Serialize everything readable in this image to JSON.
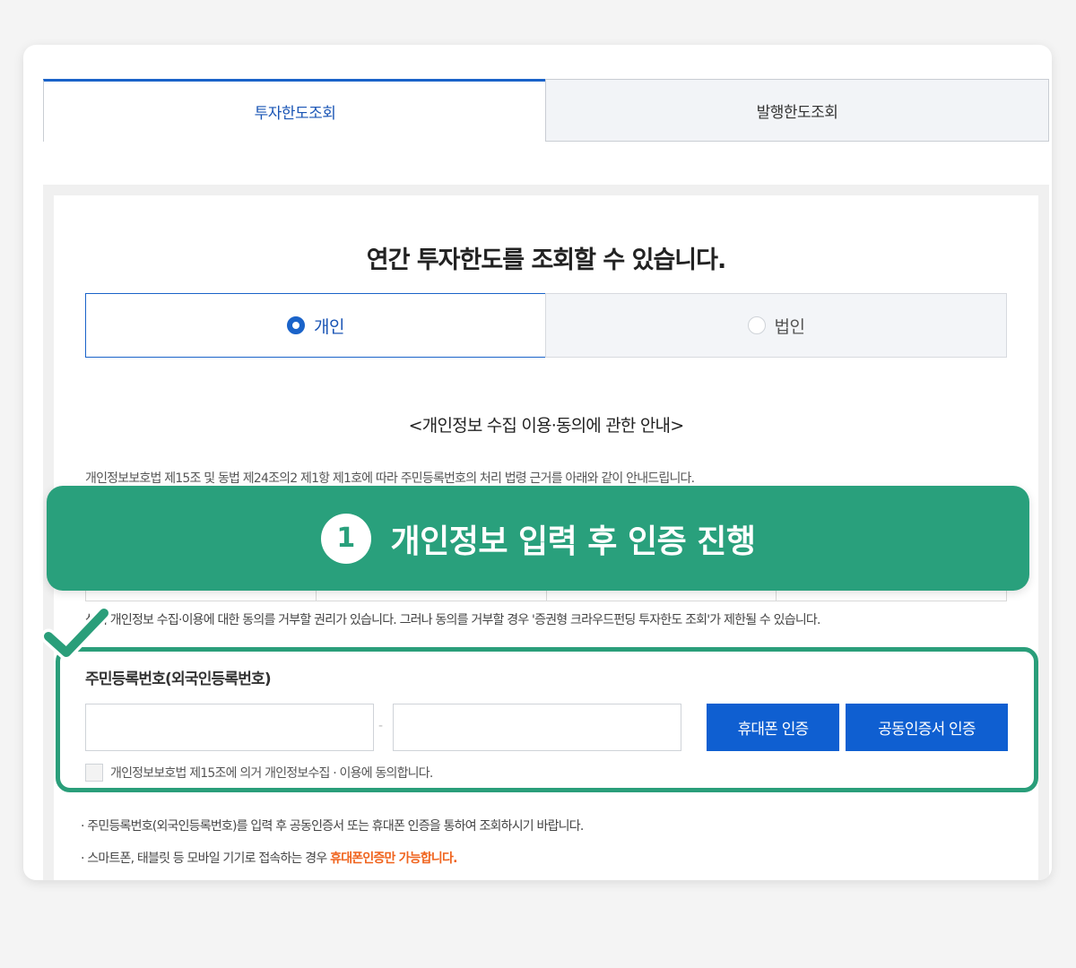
{
  "tabs": {
    "active": "투자한도조회",
    "inactive": "발행한도조회"
  },
  "main": {
    "headline": "연간 투자한도를 조회할 수 있습니다.",
    "radio": {
      "individual": "개인",
      "corporate": "법인"
    },
    "notice_title": "<개인정보 수집 이용·동의에 관한 안내>",
    "law_text": "개인정보보호법 제15조 및 동법 제24조의2 제1항 제1호에 따라 주민등록번호의 처리 법령 근거를 아래와 같이 안내드립니다.",
    "rights_text": "상기 개인정보 수집·이용에 대한 동의를 거부할 권리가 있습니다. 그러나 동의를 거부할 경우 '증권형 크라우드펀딩 투자한도 조회'가 제한될 수 있습니다.",
    "field_label": "주민등록번호(외국인등록번호)",
    "ssn_dash": "-",
    "btn_phone": "휴대폰 인증",
    "btn_cert": "공동인증서 인증",
    "agree_text": "개인정보보호법 제15조에 의거 개인정보수집 · 이용에 동의합니다.",
    "bullet1": "· 주민등록번호(외국인등록번호)를 입력 후 공동인증서 또는 휴대폰 인증을 통하여 조회하시기 바랍니다.",
    "bullet2_prefix": "· 스마트폰, 태블릿 등 모바일 기기로 접속하는 경우 ",
    "bullet2_highlight": "휴대폰인증만 가능합니다."
  },
  "overlay": {
    "step_number": "1",
    "banner_text": "개인정보 입력 후 인증 진행"
  },
  "colors": {
    "accent_blue": "#1a63c9",
    "button_blue": "#0f5fd1",
    "overlay_green": "#29a07c",
    "highlight_orange": "#f0641e"
  }
}
